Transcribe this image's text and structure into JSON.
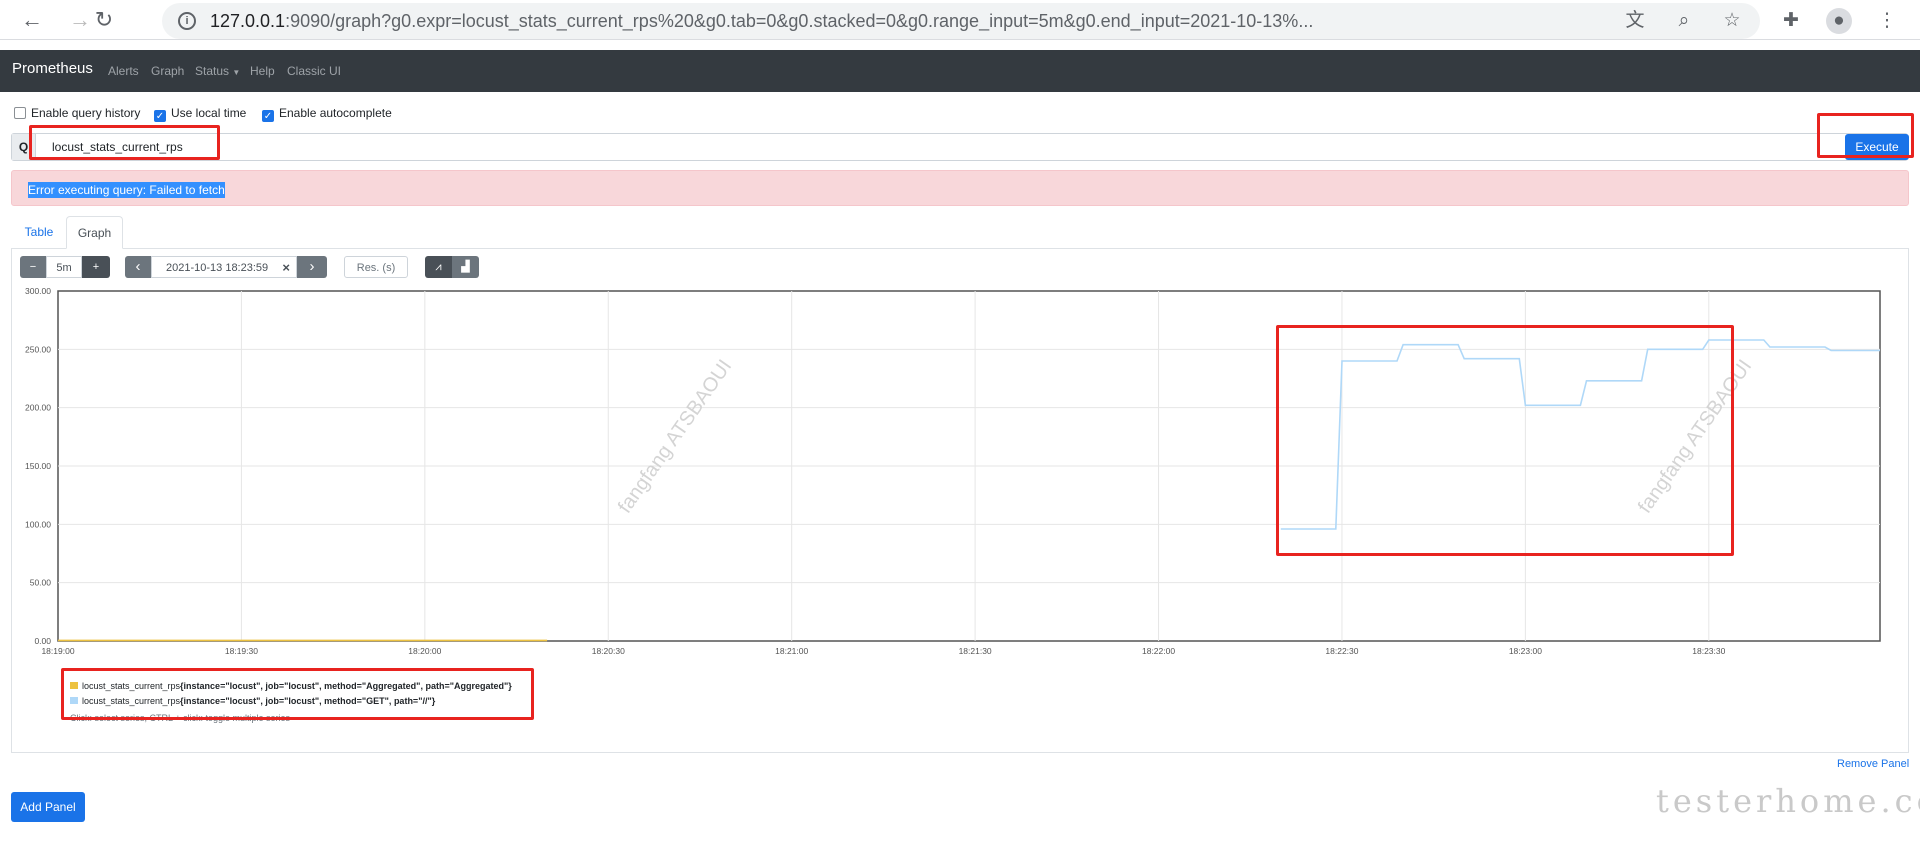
{
  "browser": {
    "url_host": "127.0.0.1",
    "url_rest": ":9090/graph?g0.expr=locust_stats_current_rps%20&g0.tab=0&g0.stacked=0&g0.range_input=5m&g0.end_input=2021-10-13%...",
    "icons": [
      "back-icon",
      "forward-icon",
      "reload-icon",
      "info-icon",
      "translate-icon",
      "zoom-icon",
      "star-icon",
      "extensions-icon",
      "profile-icon",
      "menu-icon"
    ]
  },
  "navbar": {
    "brand": "Prometheus",
    "links": [
      "Alerts",
      "Graph",
      "Status",
      "Help",
      "Classic UI"
    ]
  },
  "options": {
    "query_history": {
      "label": "Enable query history",
      "checked": false
    },
    "local_time": {
      "label": "Use local time",
      "checked": true
    },
    "autocomplete": {
      "label": "Enable autocomplete",
      "checked": true
    }
  },
  "query": {
    "prepend_icon": "search-icon",
    "value": "locust_stats_current_rps",
    "execute_label": "Execute"
  },
  "error": {
    "text": "Error executing query: Failed to fetch"
  },
  "tabs": {
    "table": "Table",
    "graph": "Graph"
  },
  "controls": {
    "minus": "−",
    "range": "5m",
    "plus": "+",
    "prev": "‹",
    "end_time": "2021-10-13 18:23:59",
    "clear": "×",
    "next": "›",
    "resolution_placeholder": "Res. (s)"
  },
  "chart_data": {
    "type": "line",
    "ylim": [
      0,
      300
    ],
    "yticks": [
      "300.00",
      "250.00",
      "200.00",
      "150.00",
      "100.00",
      "50.00",
      "0.00"
    ],
    "xticks": [
      "18:19:00",
      "18:19:30",
      "18:20:00",
      "18:20:30",
      "18:21:00",
      "18:21:30",
      "18:22:00",
      "18:22:30",
      "18:23:00",
      "18:23:30"
    ],
    "xrange_seconds": [
      0,
      298
    ],
    "series": [
      {
        "name": "locust_stats_current_rps{instance=\"locust\", job=\"locust\", method=\"Aggregated\", path=\"Aggregated\"}",
        "color": "#edc240",
        "points": [
          [
            0,
            0.5
          ],
          [
            80,
            0.5
          ]
        ]
      },
      {
        "name": "locust_stats_current_rps{instance=\"locust\", job=\"locust\", method=\"GET\", path=\"//\"}",
        "color": "#afd8f8",
        "points": [
          [
            200,
            96
          ],
          [
            209,
            96
          ],
          [
            210,
            240
          ],
          [
            219,
            240
          ],
          [
            220,
            254
          ],
          [
            229,
            254
          ],
          [
            230,
            242
          ],
          [
            239,
            242
          ],
          [
            240,
            202
          ],
          [
            249,
            202
          ],
          [
            250,
            223
          ],
          [
            259,
            223
          ],
          [
            260,
            250
          ],
          [
            269,
            250
          ],
          [
            270,
            258
          ],
          [
            279,
            258
          ],
          [
            280,
            252
          ],
          [
            289,
            252
          ],
          [
            290,
            249
          ],
          [
            298,
            249
          ]
        ]
      }
    ]
  },
  "legend": {
    "series1": {
      "prefix": "locust_stats_current_rps",
      "labels": "{instance=\"locust\", job=\"locust\", method=\"Aggregated\", path=\"Aggregated\"}"
    },
    "series2": {
      "prefix": "locust_stats_current_rps",
      "labels": "{instance=\"locust\", job=\"locust\", method=\"GET\", path=\"//\"}"
    },
    "hint": "Click: select series, CTRL + click: toggle multiple series"
  },
  "chart_watermark": "fangfang  ATSBAOUI",
  "remove_panel": "Remove Panel",
  "add_panel": "Add Panel",
  "watermark": "testerhome.com",
  "colors": {
    "accent": "#1a73e8",
    "navbar": "#343a40",
    "error_bg": "#f8d7da",
    "highlight_box": "#e8231f"
  }
}
